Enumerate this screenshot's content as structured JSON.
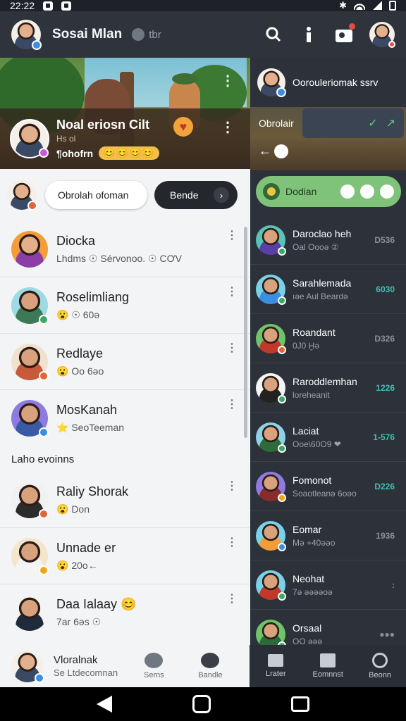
{
  "statusbar": {
    "time": "22:22"
  },
  "appbar": {
    "title": "Sosai Mlan",
    "subtitle": "tbr"
  },
  "hero": {
    "group_title": "Noal eriosn Cilt",
    "group_sub": "Hs ol",
    "group_handle": "¶ohofrn",
    "group_emojis": "😊😊😊😊"
  },
  "search": {
    "pill_label": "Obrolah ofoman",
    "dark_pill_label": "Bende"
  },
  "left_list": [
    {
      "name": "Diocka",
      "sub": "Lhdms ☉ Sérvonoo. ☉ CƠV"
    },
    {
      "name": "Roselimliang",
      "sub": "😮 ☉ 60ə"
    },
    {
      "name": "Redlaye",
      "sub": "😮 Oo 6əo"
    },
    {
      "name": "MosKanah",
      "sub": "⭐ SeoTeeman"
    }
  ],
  "section_label": "Laho evoinns",
  "left_list_2": [
    {
      "name": "Raliy Shorak",
      "sub": "😮 Don"
    },
    {
      "name": "Unnade er",
      "sub": "😮 20o←"
    },
    {
      "name": "Daa  Ialaay 😊",
      "sub": "7ar 6əs ☉"
    }
  ],
  "right_panel": {
    "profile_name": "Oorouleriomak ssrv",
    "field_label": "Obrolair",
    "green_label": "Dodian"
  },
  "right_list": [
    {
      "name": "Daroclao heh",
      "sub": "Oal Oooə ②",
      "time": "D536"
    },
    {
      "name": "Sarahlemada",
      "sub": "ıəe Aul Beardə",
      "time": "6030"
    },
    {
      "name": "Roandant",
      "sub": "0J0 Ḫə",
      "time": "D326"
    },
    {
      "name": "Raroddlemhan",
      "sub": "loreheanit",
      "time": "1226"
    },
    {
      "name": "Laciat",
      "sub": "Ooe\\60O9 ❤",
      "time": "1-576"
    },
    {
      "name": "Fomonot",
      "sub": "Soaotleanə 6oəo",
      "time": "D226"
    },
    {
      "name": "Eomar",
      "sub": "Mə +40əəo",
      "time": "1936"
    },
    {
      "name": "Neohat",
      "sub": "7ə əəəəoə",
      "time": ":"
    },
    {
      "name": "Orsaal",
      "sub": "OO əəə",
      "time": "●●●"
    }
  ],
  "bottomnav": {
    "profile_name": "Vloralnak",
    "profile_sub": "Se Ltdecomnan",
    "left_tabs": [
      "Serns",
      "Bandle"
    ],
    "right_tabs": [
      "Lrater",
      "Eomnnst",
      "Beonn"
    ]
  },
  "colors": {
    "accent_green": "#7fc37a",
    "teal_time": "#3fc0b0",
    "notify_red": "#e74c3c"
  }
}
